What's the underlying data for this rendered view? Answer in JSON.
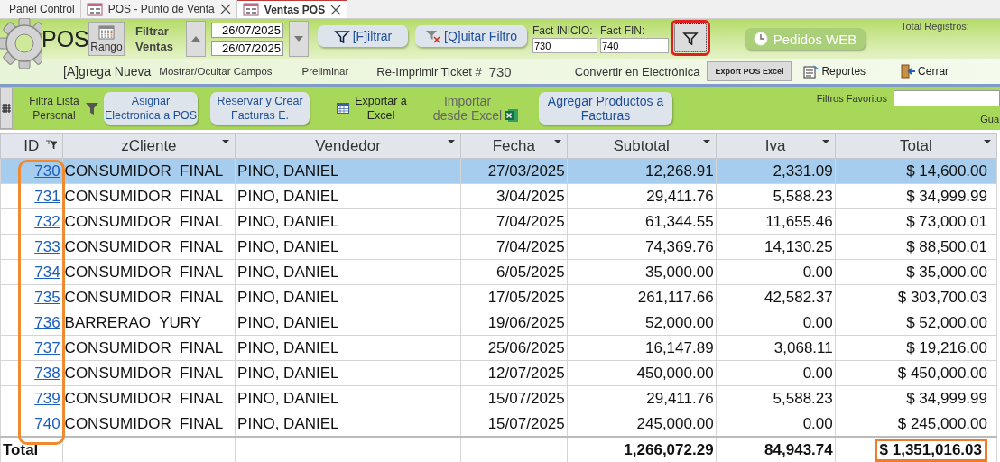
{
  "tabs": [
    {
      "label": "Panel Control",
      "selected": false,
      "closable": false
    },
    {
      "label": "POS - Punto de Venta",
      "selected": false,
      "closable": true
    },
    {
      "label": "Ventas POS",
      "selected": true,
      "closable": true
    }
  ],
  "header": {
    "app_title": "POS",
    "range_button": "Rango",
    "filter_label": "Filtrar Ventas",
    "date_from": "26/07/2025",
    "date_to": "26/07/2025",
    "filter_button": "[F]iltrar",
    "clear_filter_button": "[Q]uitar Filtro",
    "fact_start_label": "Fact INICIO:",
    "fact_start": "730",
    "fact_end_label": "Fact FIN:",
    "fact_end": "740",
    "web_orders_button": "Pedidos WEB",
    "total_records_label": "Total Registros:"
  },
  "actions": {
    "add_new": "[A]grega Nueva",
    "toggle_fields": "Mostrar/Ocultar Campos",
    "preview": "Preliminar",
    "reprint_label": "Re-Imprimir Ticket #",
    "reprint_number": "730",
    "convert": "Convertir en Electrónica",
    "export_button": "Export POS Excel",
    "reports": "Reportes",
    "close": "Cerrar"
  },
  "toolbar": {
    "personal_filter": "Filtra Lista Personal",
    "assign_button": "Asignar Electronica a POS",
    "reserve_button": "Reservar y Crear Facturas E.",
    "export_excel": "Exportar a Excel",
    "import_excel": "Importar desde Excel",
    "add_products_button": "Agregar Productos a Facturas",
    "favorites_label": "Filtros Favoritos",
    "save_label": "Gua"
  },
  "table": {
    "columns": [
      "ID",
      "zCliente",
      "Vendedor",
      "Fecha",
      "Subtotal",
      "Iva",
      "Total"
    ],
    "rows": [
      {
        "id": "730",
        "cliente": "CONSUMIDOR  FINAL",
        "vendedor": "PINO, DANIEL",
        "fecha": "27/03/2025",
        "subtotal": "12,268.91",
        "iva": "2,331.09",
        "total": "$ 14,600.00",
        "selected": true
      },
      {
        "id": "731",
        "cliente": "CONSUMIDOR  FINAL",
        "vendedor": "PINO, DANIEL",
        "fecha": "3/04/2025",
        "subtotal": "29,411.76",
        "iva": "5,588.23",
        "total": "$ 34,999.99",
        "selected": false
      },
      {
        "id": "732",
        "cliente": "CONSUMIDOR  FINAL",
        "vendedor": "PINO, DANIEL",
        "fecha": "7/04/2025",
        "subtotal": "61,344.55",
        "iva": "11,655.46",
        "total": "$ 73,000.01",
        "selected": false
      },
      {
        "id": "733",
        "cliente": "CONSUMIDOR  FINAL",
        "vendedor": "PINO, DANIEL",
        "fecha": "7/04/2025",
        "subtotal": "74,369.76",
        "iva": "14,130.25",
        "total": "$ 88,500.01",
        "selected": false
      },
      {
        "id": "734",
        "cliente": "CONSUMIDOR  FINAL",
        "vendedor": "PINO, DANIEL",
        "fecha": "6/05/2025",
        "subtotal": "35,000.00",
        "iva": "0.00",
        "total": "$ 35,000.00",
        "selected": false
      },
      {
        "id": "735",
        "cliente": "CONSUMIDOR  FINAL",
        "vendedor": "PINO, DANIEL",
        "fecha": "17/05/2025",
        "subtotal": "261,117.66",
        "iva": "42,582.37",
        "total": "$ 303,700.03",
        "selected": false
      },
      {
        "id": "736",
        "cliente": "BARRERAO  YURY",
        "vendedor": "PINO, DANIEL",
        "fecha": "19/06/2025",
        "subtotal": "52,000.00",
        "iva": "0.00",
        "total": "$ 52,000.00",
        "selected": false
      },
      {
        "id": "737",
        "cliente": "CONSUMIDOR  FINAL",
        "vendedor": "PINO, DANIEL",
        "fecha": "25/06/2025",
        "subtotal": "16,147.89",
        "iva": "3,068.11",
        "total": "$ 19,216.00",
        "selected": false
      },
      {
        "id": "738",
        "cliente": "CONSUMIDOR  FINAL",
        "vendedor": "PINO, DANIEL",
        "fecha": "12/07/2025",
        "subtotal": "450,000.00",
        "iva": "0.00",
        "total": "$ 450,000.00",
        "selected": false
      },
      {
        "id": "739",
        "cliente": "CONSUMIDOR  FINAL",
        "vendedor": "PINO, DANIEL",
        "fecha": "15/07/2025",
        "subtotal": "29,411.76",
        "iva": "5,588.23",
        "total": "$ 34,999.99",
        "selected": false
      },
      {
        "id": "740",
        "cliente": "CONSUMIDOR  FINAL",
        "vendedor": "PINO, DANIEL",
        "fecha": "15/07/2025",
        "subtotal": "245,000.00",
        "iva": "0.00",
        "total": "$ 245,000.00",
        "selected": false
      }
    ],
    "totals": {
      "label": "Total",
      "subtotal": "1,266,072.29",
      "iva": "84,943.74",
      "total": "$ 1,351,016.03"
    }
  }
}
